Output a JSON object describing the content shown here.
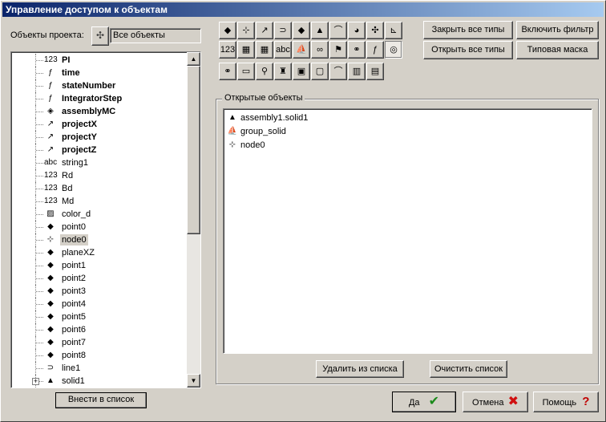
{
  "window": {
    "title": "Управление доступом к объектам"
  },
  "project": {
    "label": "Объекты проекта:",
    "combo_value": "Все объекты",
    "add_button": "Внести в список"
  },
  "tree": [
    {
      "icon": "123",
      "label": "PI",
      "bold": true
    },
    {
      "icon": "ƒ",
      "label": "time",
      "bold": true
    },
    {
      "icon": "ƒ",
      "label": "stateNumber",
      "bold": true
    },
    {
      "icon": "ƒ",
      "label": "IntegratorStep",
      "bold": true
    },
    {
      "icon": "◈",
      "label": "assemblyMC",
      "bold": true
    },
    {
      "icon": "↗",
      "label": "projectX",
      "bold": true
    },
    {
      "icon": "↗",
      "label": "projectY",
      "bold": true
    },
    {
      "icon": "↗",
      "label": "projectZ",
      "bold": true
    },
    {
      "icon": "abc",
      "label": "string1",
      "bold": false
    },
    {
      "icon": "123",
      "label": "Rd",
      "bold": false
    },
    {
      "icon": "123",
      "label": "Bd",
      "bold": false
    },
    {
      "icon": "123",
      "label": "Md",
      "bold": false
    },
    {
      "icon": "▨",
      "label": "color_d",
      "bold": false
    },
    {
      "icon": "◆",
      "label": "point0",
      "bold": false
    },
    {
      "icon": "⊹",
      "label": "node0",
      "bold": false,
      "selected": true
    },
    {
      "icon": "◆",
      "label": "planeXZ",
      "bold": false
    },
    {
      "icon": "◆",
      "label": "point1",
      "bold": false
    },
    {
      "icon": "◆",
      "label": "point2",
      "bold": false
    },
    {
      "icon": "◆",
      "label": "point3",
      "bold": false
    },
    {
      "icon": "◆",
      "label": "point4",
      "bold": false
    },
    {
      "icon": "◆",
      "label": "point5",
      "bold": false
    },
    {
      "icon": "◆",
      "label": "point6",
      "bold": false
    },
    {
      "icon": "◆",
      "label": "point7",
      "bold": false
    },
    {
      "icon": "◆",
      "label": "point8",
      "bold": false
    },
    {
      "icon": "⊃",
      "label": "line1",
      "bold": false
    },
    {
      "icon": "▲",
      "label": "solid1",
      "bold": false,
      "expandable": true
    }
  ],
  "toolbar": {
    "row1": [
      "◆",
      "⊹",
      "↗",
      "⊃",
      "◆",
      "▲",
      "⌒",
      "◕",
      "✣",
      "⊾"
    ],
    "row2": [
      "123",
      "▦",
      "▦",
      "abc",
      "⛵",
      "∞",
      "⚑",
      "⚭",
      "ƒ",
      "◎"
    ],
    "row3": [
      "⚭",
      "▭",
      "⚲",
      "♜",
      "▣",
      "▢",
      "⌒",
      "▥",
      "▤"
    ],
    "icon_names": [
      "point",
      "node",
      "vector",
      "line",
      "plane",
      "solid",
      "arc",
      "sphere",
      "assembly",
      "axes",
      "number",
      "grid",
      "matrix",
      "string",
      "ship",
      "link",
      "flag",
      "joint",
      "function",
      "circle",
      "spring",
      "rect",
      "lamp",
      "bell",
      "frame",
      "box",
      "rainbow",
      "barchart",
      "stack"
    ]
  },
  "buttons": {
    "close_all": "Закрыть все типы",
    "open_all": "Открыть все типы",
    "enable_filter": "Включить фильтр",
    "type_mask": "Типовая маска",
    "remove": "Удалить из списка",
    "clear": "Очистить список",
    "ok": "Да",
    "cancel": "Отмена",
    "help": "Помощь"
  },
  "open_objects": {
    "title": "Открытые объекты",
    "items": [
      {
        "icon": "▲",
        "label": "assembly1.solid1"
      },
      {
        "icon": "⛵",
        "label": "group_solid"
      },
      {
        "icon": "⊹",
        "label": "node0"
      }
    ]
  }
}
